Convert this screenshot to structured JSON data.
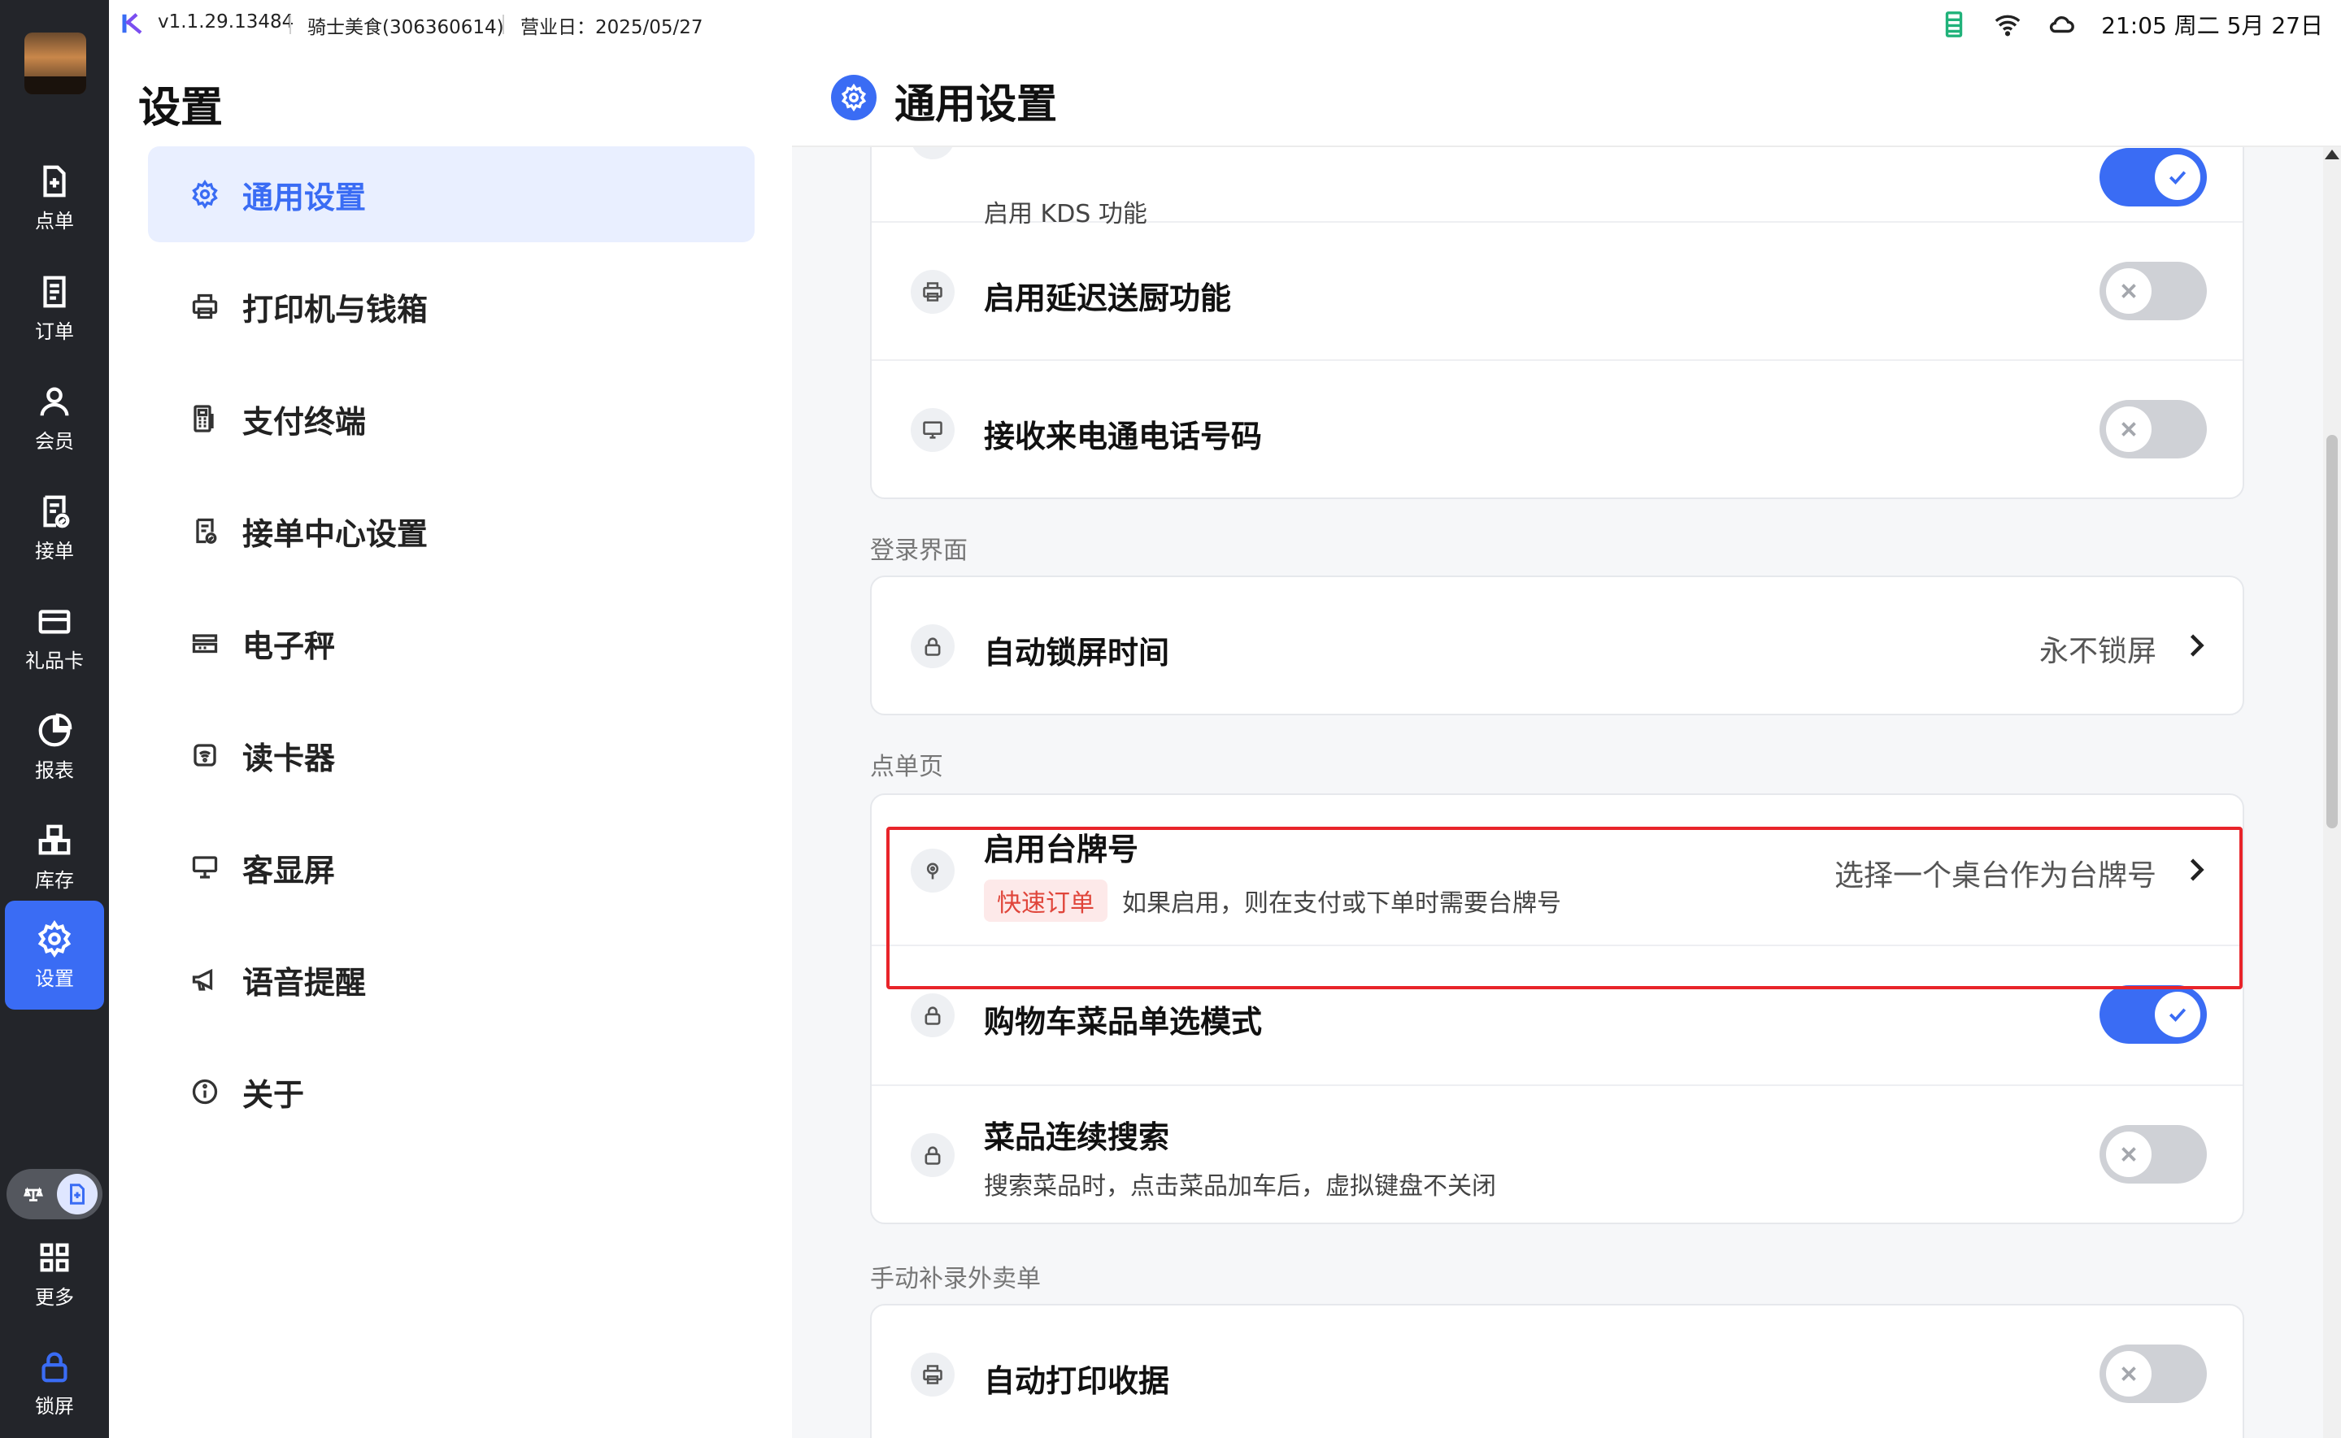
{
  "topbar": {
    "version": "v1.1.29.13484",
    "store": "骑士美食(306360614)",
    "business_day": "营业日：2025/05/27",
    "clock": "21:05 周二 5月 27日"
  },
  "rail": {
    "items": [
      {
        "label": "点单"
      },
      {
        "label": "订单"
      },
      {
        "label": "会员"
      },
      {
        "label": "接单"
      },
      {
        "label": "礼品卡"
      },
      {
        "label": "报表"
      },
      {
        "label": "库存"
      },
      {
        "label": "设置"
      },
      {
        "label": "更多"
      },
      {
        "label": "锁屏"
      }
    ]
  },
  "nav": {
    "title": "设置",
    "items": [
      {
        "label": "通用设置"
      },
      {
        "label": "打印机与钱箱"
      },
      {
        "label": "支付终端"
      },
      {
        "label": "接单中心设置"
      },
      {
        "label": "电子秤"
      },
      {
        "label": "读卡器"
      },
      {
        "label": "客显屏"
      },
      {
        "label": "语音提醒"
      },
      {
        "label": "关于"
      }
    ]
  },
  "content": {
    "title": "通用设置",
    "card1": {
      "kds_subtitle": "启用 KDS 功能",
      "delay_kitchen": "启用延迟送厨功能",
      "caller_id": "接收来电通电话号码"
    },
    "section_login": "登录界面",
    "auto_lock": {
      "title": "自动锁屏时间",
      "value": "永不锁屏"
    },
    "section_order": "点单页",
    "table_tag": {
      "title": "启用台牌号",
      "tag": "快速订单",
      "subtitle": "如果启用，则在支付或下单时需要台牌号",
      "value": "选择一个桌台作为台牌号"
    },
    "cart_single": "购物车菜品单选模式",
    "continuous_search": {
      "title": "菜品连续搜索",
      "subtitle": "搜索菜品时，点击菜品加车后，虚拟键盘不关闭"
    },
    "section_manual": "手动补录外卖单",
    "auto_print": "自动打印收据"
  },
  "switches": {
    "kds": "on",
    "delay_kitchen": "off",
    "caller_id": "off",
    "cart_single": "on",
    "continuous_search": "off",
    "auto_print": "off"
  },
  "colors": {
    "accent": "#3a6cf4",
    "rail_bg": "#23252a",
    "highlight": "#e8242a",
    "tag_text": "#e0453a",
    "tag_bg": "#fde9e9",
    "status_icon": "#20b27a"
  },
  "icons": {
    "status": [
      "battery-icon",
      "wifi-icon",
      "cloud-icon"
    ]
  }
}
